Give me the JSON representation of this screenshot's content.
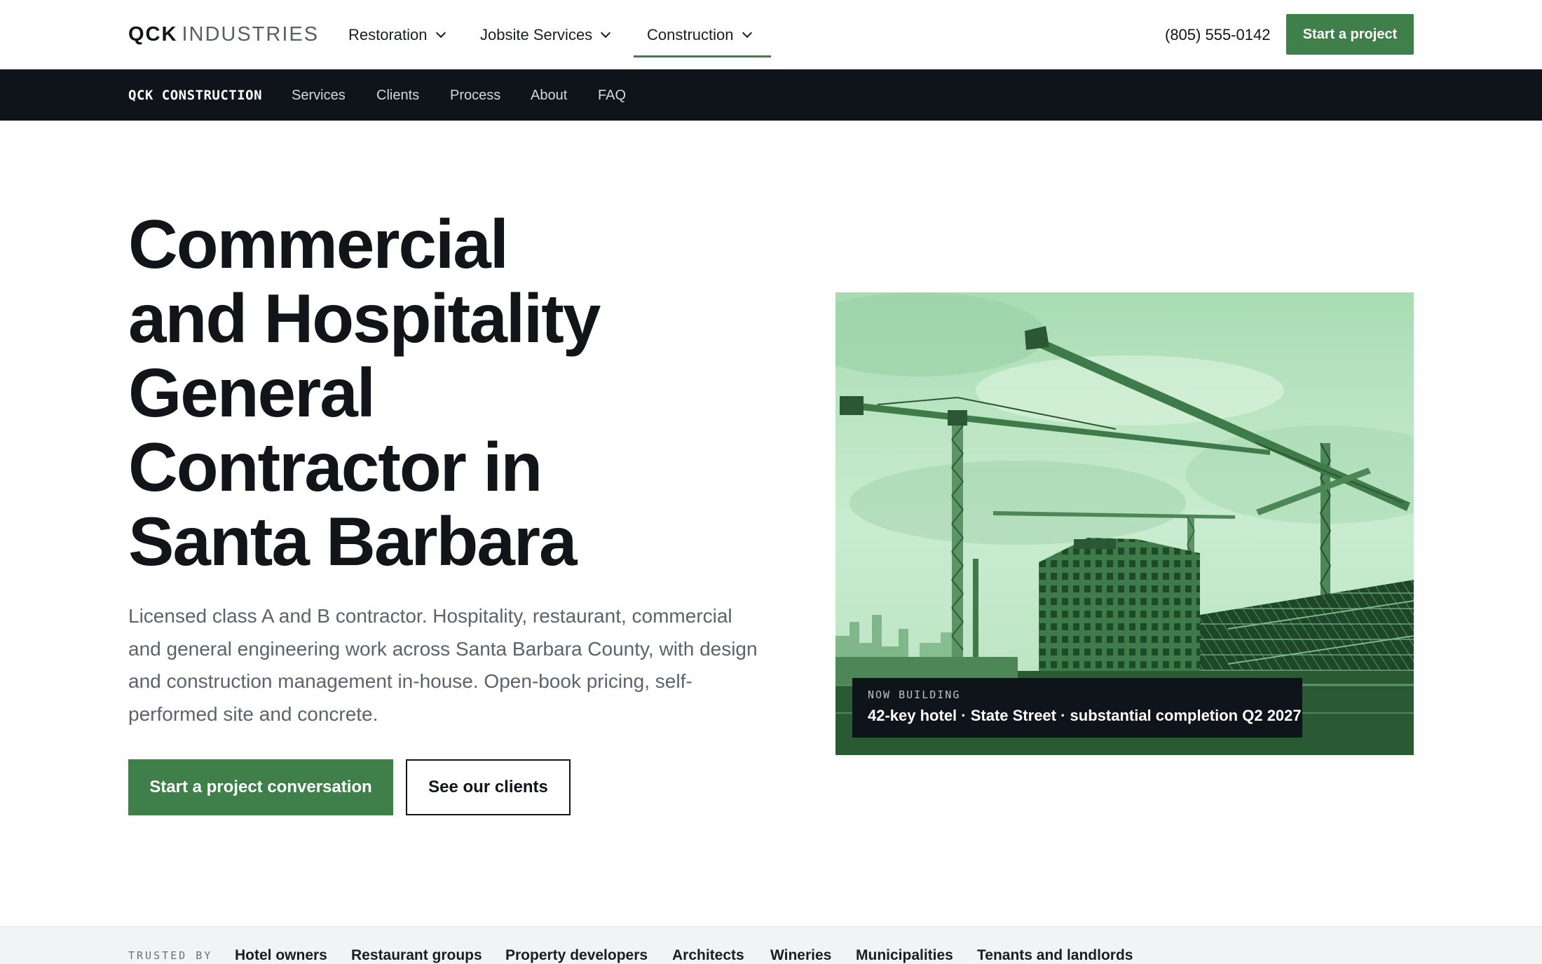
{
  "brand": {
    "name_bold": "QCK",
    "name_light": "INDUSTRIES"
  },
  "nav": {
    "items": [
      {
        "label": "Restoration"
      },
      {
        "label": "Jobsite Services"
      },
      {
        "label": "Construction",
        "active": true
      }
    ],
    "phone": "(805) 555-0142",
    "cta": "Start a project"
  },
  "subnav": {
    "brand": "QCK CONSTRUCTION",
    "links": [
      "Services",
      "Clients",
      "Process",
      "About",
      "FAQ"
    ]
  },
  "hero": {
    "headline_lines": [
      "Commercial",
      "and Hospitality",
      "General",
      "Contractor in",
      "Santa Barbara"
    ],
    "lede": "Licensed class A and B contractor. Hospitality, restaurant, commercial and general engineering work across Santa Barbara County, with design and construction management in-house. Open-book pricing, self-performed site and concrete.",
    "primary_cta": "Start a project conversation",
    "secondary_cta": "See our clients",
    "image": {
      "icon": "construction-cranes-photo"
    },
    "caption": {
      "kicker": "NOW BUILDING",
      "text": "42-key hotel · State Street · substantial completion Q2 2027"
    }
  },
  "trusted": {
    "label": "TRUSTED BY",
    "items": [
      "Hotel owners",
      "Restaurant groups",
      "Property developers",
      "Architects",
      "Wineries",
      "Municipalities",
      "Tenants and landlords"
    ]
  },
  "colors": {
    "accent": "#3f7f4a",
    "dark": "#0f141a",
    "text": "#111418",
    "muted": "#5d636b"
  }
}
